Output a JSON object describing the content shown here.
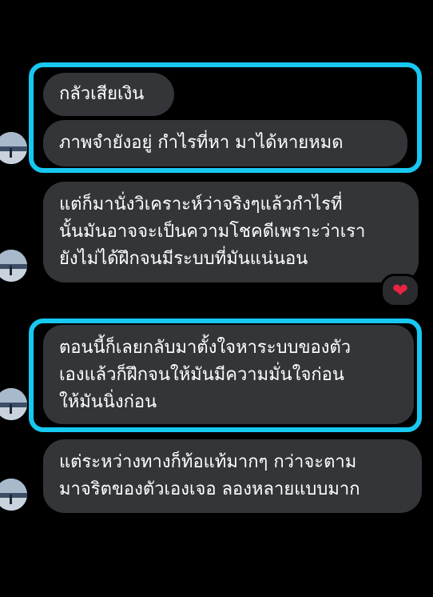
{
  "messages": [
    {
      "id": "m1",
      "lines": [
        "กลัวเสียเงิน"
      ]
    },
    {
      "id": "m2",
      "lines": [
        "ภาพจำยังอยู่ กำไรที่หา มาได้หายหมด"
      ]
    },
    {
      "id": "m3",
      "lines": [
        "แต่ก็มานั่งวิเคราะห์ว่าจริงๆแล้วกำไรที่",
        "นั้นมันอาจจะเป็นความโชคดีเพราะว่าเรา",
        "ยังไม่ได้ฝึกจนมีระบบที่มันแน่นอน"
      ]
    },
    {
      "id": "m4",
      "lines": [
        "ตอนนี้ก็เลยกลับมาตั้งใจหาระบบของตัว",
        "เองแล้วก็ฝึกจนให้มันมีความมั่นใจก่อน",
        "ให้มันนิ่งก่อน"
      ]
    },
    {
      "id": "m5",
      "lines": [
        "แต่ระหว่างทางก็ท้อแท้มากๆ กว่าจะตาม",
        "มาจริตของตัวเองเจอ ลองหลายแบบมาก"
      ]
    }
  ],
  "reaction": {
    "emoji": "❤",
    "color": "#e8243f"
  },
  "colors": {
    "bubble": "#333538",
    "highlight": "#17c8f0",
    "background": "#000000"
  }
}
